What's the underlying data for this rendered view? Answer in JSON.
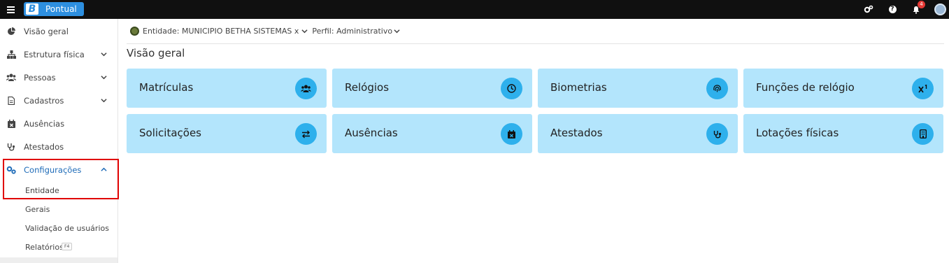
{
  "app": {
    "brand_letter": "B",
    "brand_name": "Pontual",
    "notification_count": "4",
    "help_label": "?"
  },
  "sidebar": {
    "items": [
      {
        "label": "Visão geral",
        "icon": "pie-chart-icon"
      },
      {
        "label": "Estrutura física",
        "icon": "sitemap-icon",
        "expandable": true
      },
      {
        "label": "Pessoas",
        "icon": "users-icon",
        "expandable": true
      },
      {
        "label": "Cadastros",
        "icon": "document-icon",
        "expandable": true
      },
      {
        "label": "Ausências",
        "icon": "calendar-x-icon"
      },
      {
        "label": "Atestados",
        "icon": "stethoscope-icon"
      },
      {
        "label": "Configurações",
        "icon": "gears-icon",
        "expandable": true,
        "expanded": true
      }
    ],
    "sub_items": [
      {
        "label": "Entidade"
      },
      {
        "label": "Gerais"
      },
      {
        "label": "Validação de usuários"
      },
      {
        "label": "Relatórios",
        "shortcut": "F4"
      }
    ]
  },
  "context": {
    "entity_label": "Entidade: MUNICIPIO BETHA SISTEMAS x",
    "profile_label": "Perfil: Administrativo"
  },
  "page": {
    "title": "Visão geral"
  },
  "cards": [
    {
      "label": "Matrículas",
      "icon": "users-icon"
    },
    {
      "label": "Relógios",
      "icon": "clock-icon"
    },
    {
      "label": "Biometrias",
      "icon": "fingerprint-icon"
    },
    {
      "label": "Funções de relógio",
      "icon": "superscript-icon"
    },
    {
      "label": "Solicitações",
      "icon": "exchange-icon"
    },
    {
      "label": "Ausências",
      "icon": "calendar-x-icon"
    },
    {
      "label": "Atestados",
      "icon": "stethoscope-icon"
    },
    {
      "label": "Lotações físicas",
      "icon": "building-icon"
    }
  ],
  "colors": {
    "card_bg": "#b3e5fc",
    "card_icon_bg": "#2eb0ec",
    "brand": "#2d8fe0",
    "highlight": "#e00000",
    "active_nav": "#1e6bb8"
  }
}
